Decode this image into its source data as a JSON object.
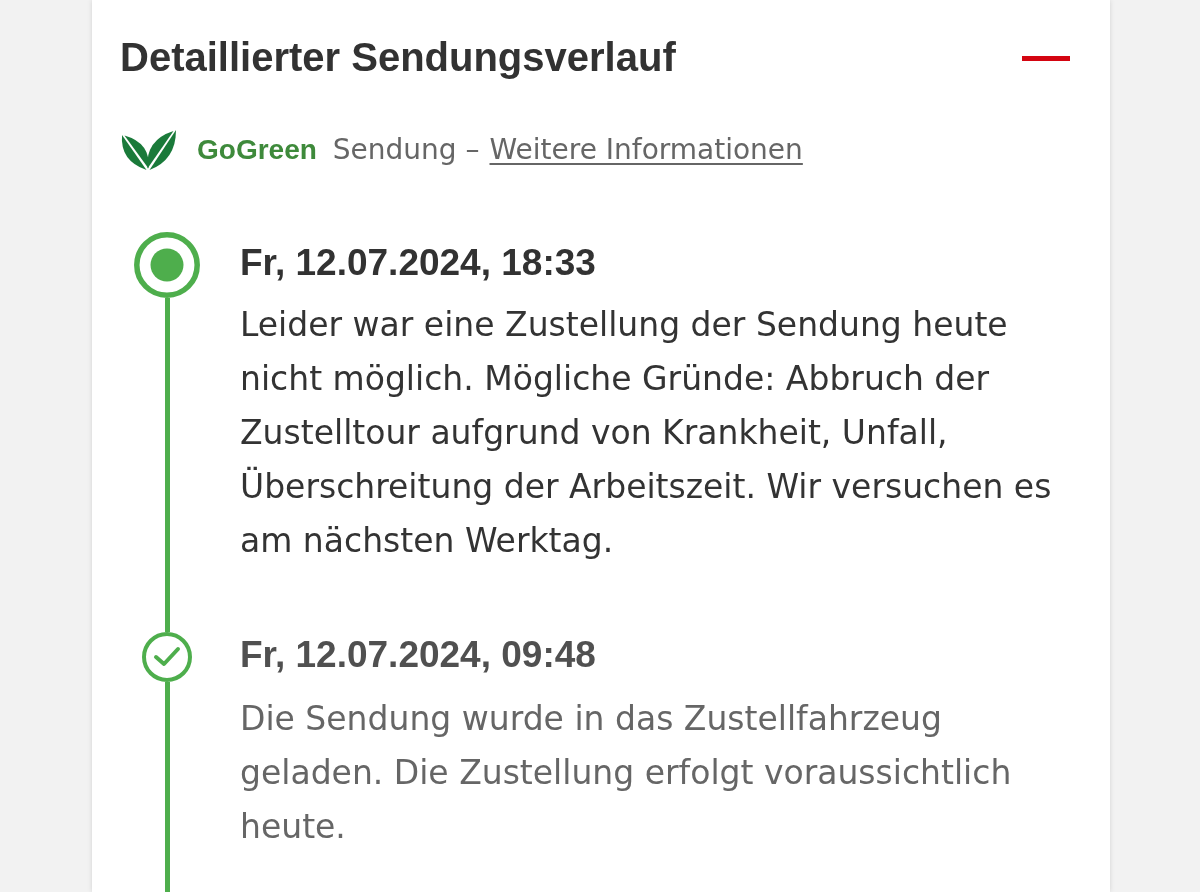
{
  "panel": {
    "title": "Detaillierter Sendungsverlauf",
    "expanded": true
  },
  "gogreen": {
    "brand": "GoGreen",
    "text": "Sendung –",
    "link": "Weitere Informationen"
  },
  "events": [
    {
      "date": "Fr, 12.07.2024, 18:33",
      "description": "Leider war eine Zustellung der Sendung heute nicht möglich. Mögliche Gründe: Abbruch der Zustelltour aufgrund von Krankheit, Unfall, Überschreitung der Arbeitszeit. Wir versuchen es am nächsten Werktag.",
      "current": true
    },
    {
      "date": "Fr, 12.07.2024, 09:48",
      "description": "Die Sendung wurde in das Zustellfahrzeug geladen. Die Zustellung erfolgt voraussichtlich heute.",
      "current": false
    }
  ]
}
